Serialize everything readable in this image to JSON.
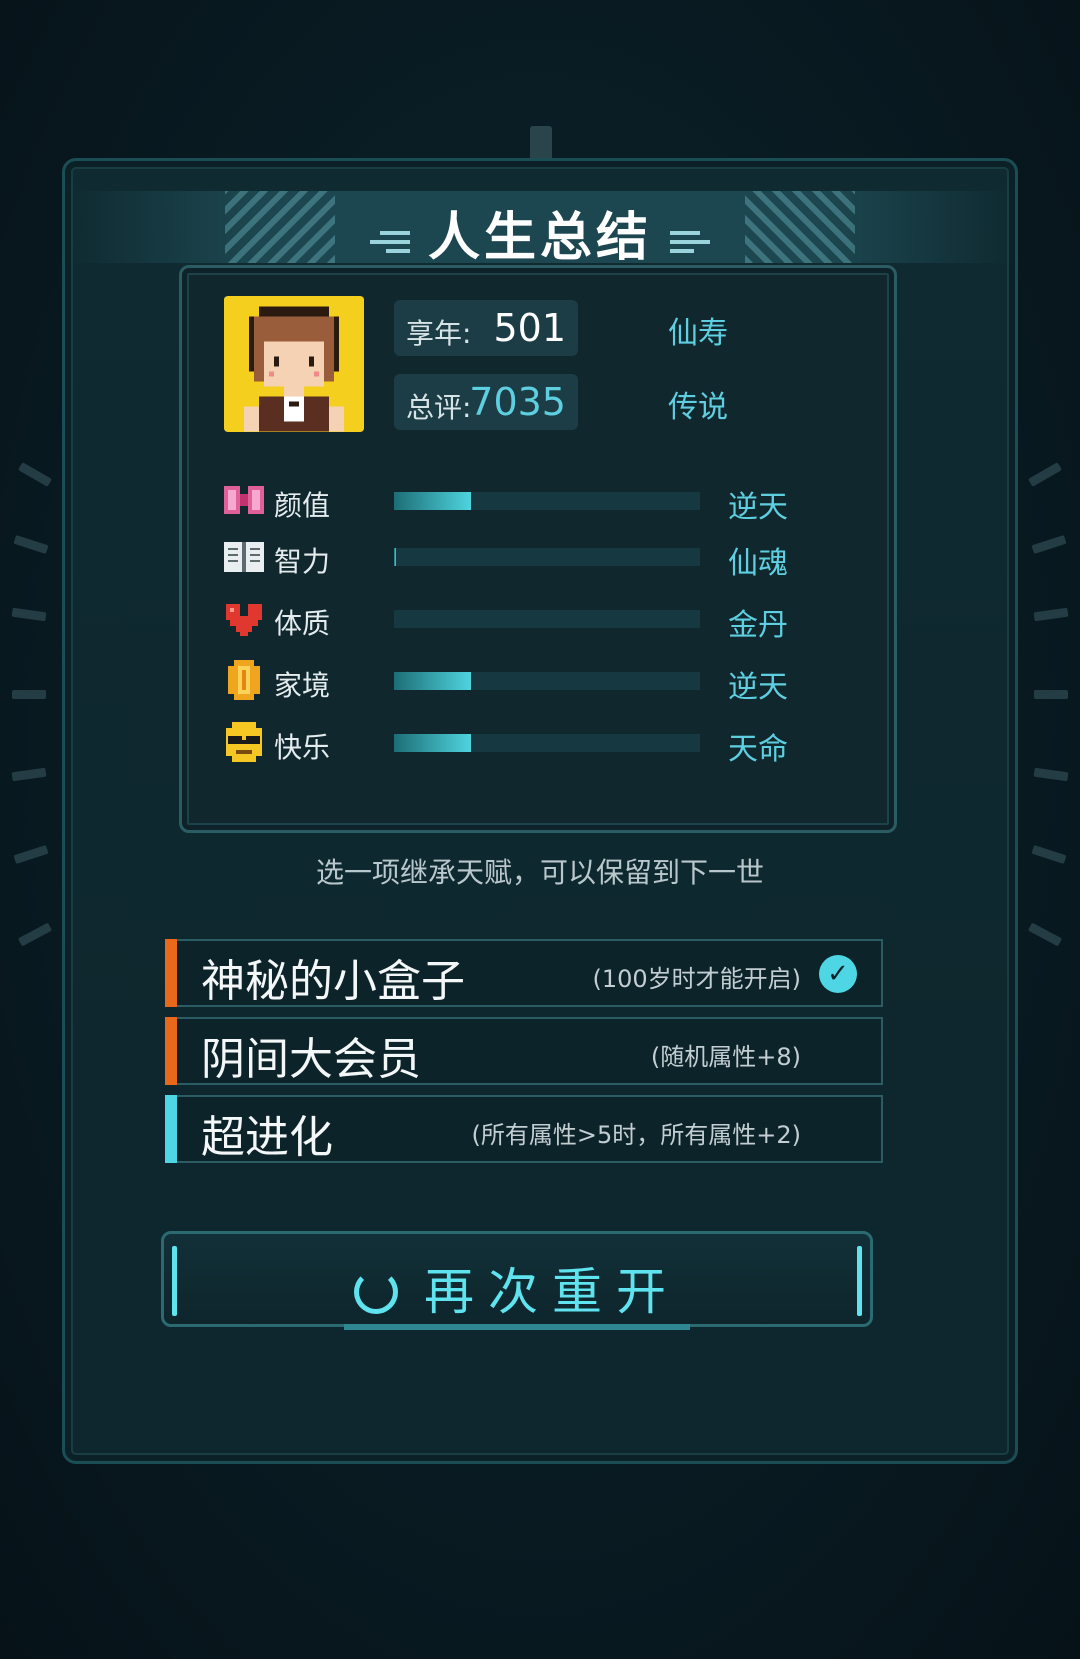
{
  "title": "人生总结",
  "summary": {
    "age_label": "享年:",
    "age_value": "501",
    "age_rank": "仙寿",
    "score_label": "总评:",
    "score_value": "7035",
    "score_rank": "传说"
  },
  "attributes": [
    {
      "name": "颜值",
      "rank": "逆天",
      "icon": "bow-icon",
      "level": 0.25
    },
    {
      "name": "智力",
      "rank": "仙魂",
      "icon": "book-icon",
      "level": 0.01
    },
    {
      "name": "体质",
      "rank": "金丹",
      "icon": "heart-icon",
      "level": 0.0
    },
    {
      "name": "家境",
      "rank": "逆天",
      "icon": "coin-icon",
      "level": 0.25
    },
    {
      "name": "快乐",
      "rank": "天命",
      "icon": "sunglasses-face-icon",
      "level": 0.25
    }
  ],
  "prompt": "选一项继承天赋，可以保留到下一世",
  "talents": [
    {
      "name": "神秘的小盒子",
      "desc": "(100岁时才能开启)",
      "color": "#e8691c",
      "selected": true
    },
    {
      "name": "阴间大会员",
      "desc": "(随机属性+8)",
      "color": "#e8691c",
      "selected": false
    },
    {
      "name": "超进化",
      "desc": "(所有属性>5时，所有属性+2)",
      "color": "#4fd6e4",
      "selected": false
    }
  ],
  "restart_label": "再次重开",
  "colors": {
    "accent": "#5fe3ef",
    "highlight": "#e8691c",
    "avatar_bg": "#f5cf1d"
  }
}
